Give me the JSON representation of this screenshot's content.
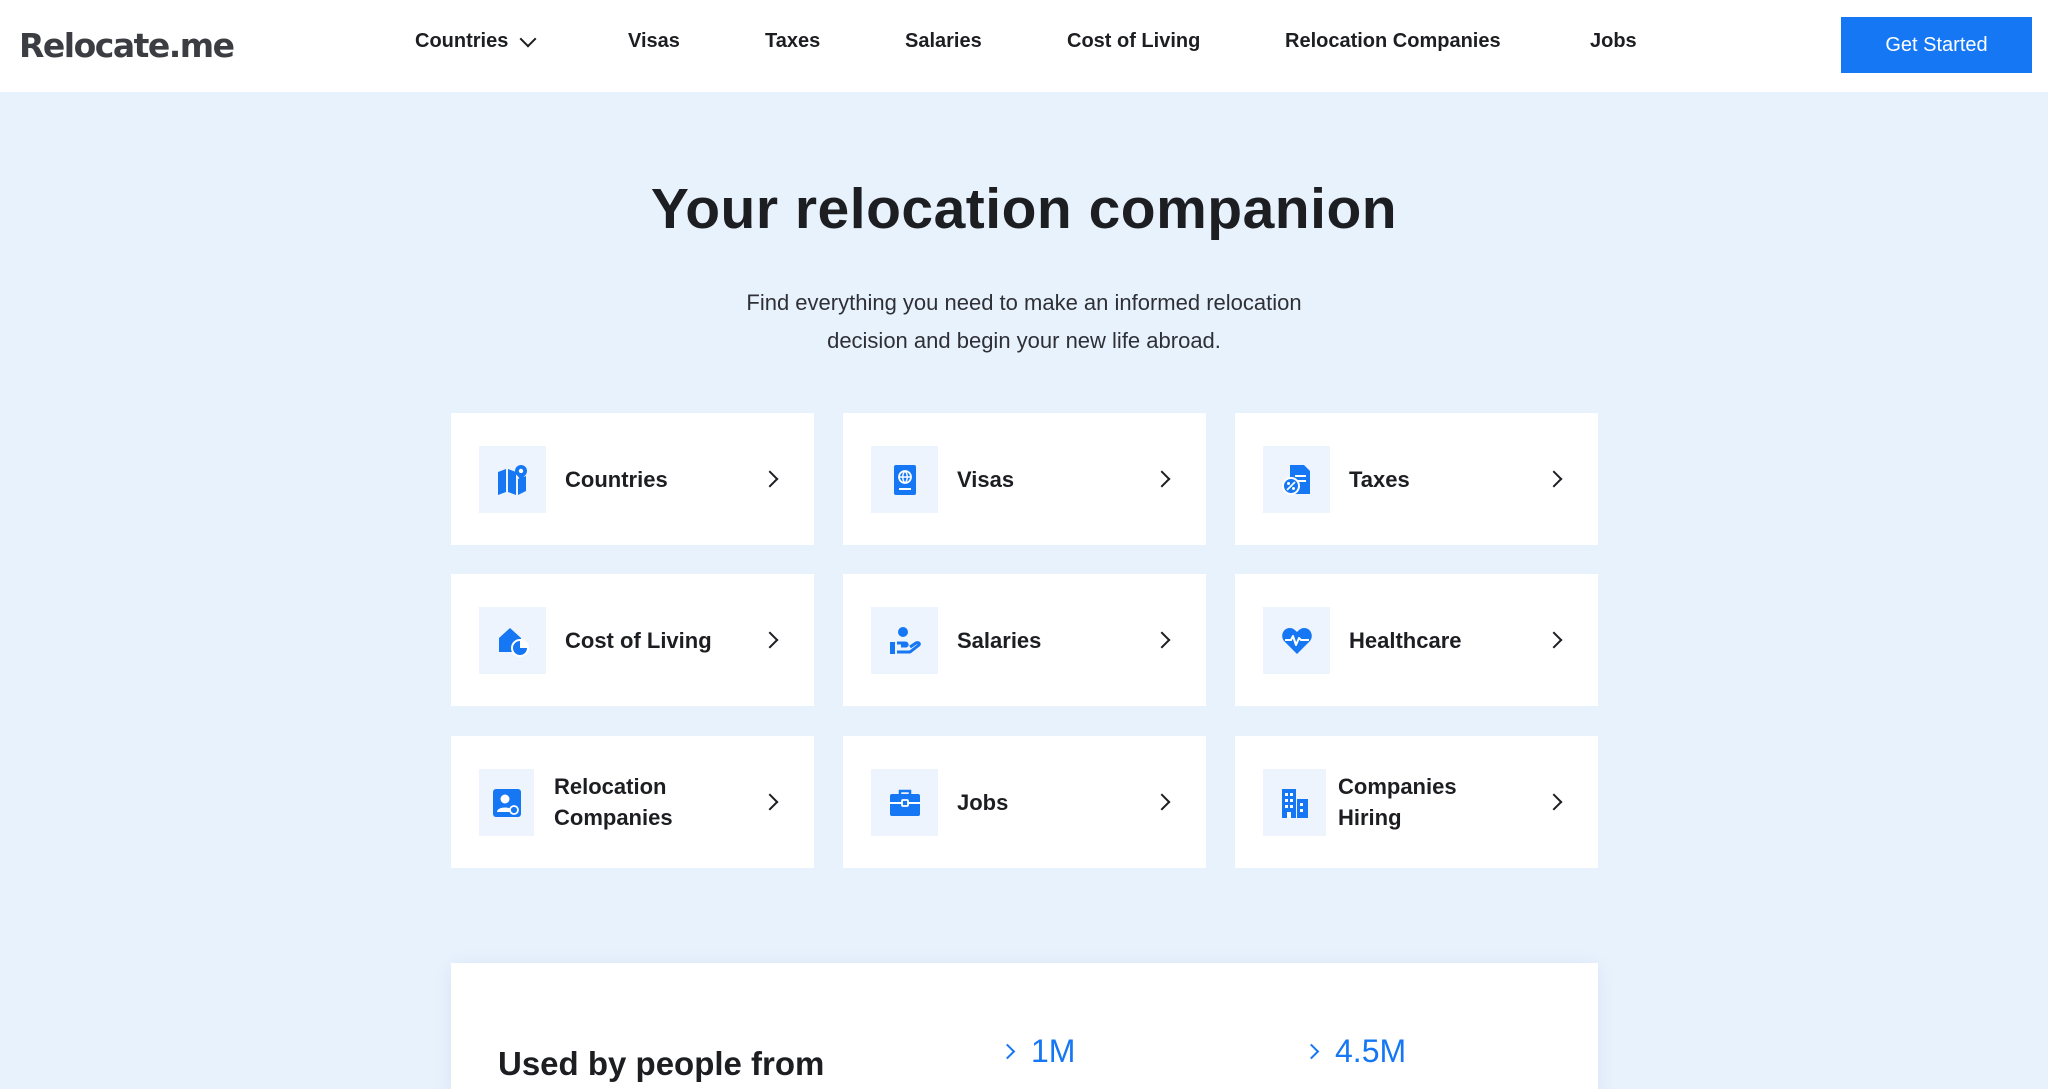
{
  "brand": {
    "logo": "Relocate.me"
  },
  "nav": {
    "items": [
      "Countries",
      "Visas",
      "Taxes",
      "Salaries",
      "Cost of Living",
      "Relocation Companies",
      "Jobs"
    ],
    "cta": "Get Started"
  },
  "hero": {
    "title": "Your relocation companion",
    "subtitle_line1": "Find everything you need to make an informed relocation",
    "subtitle_line2": "decision and begin your new life abroad."
  },
  "cards": [
    {
      "label": "Countries",
      "icon": "map-pin-icon"
    },
    {
      "label": "Visas",
      "icon": "passport-icon"
    },
    {
      "label": "Taxes",
      "icon": "tax-document-icon"
    },
    {
      "label": "Cost of Living",
      "icon": "house-price-icon"
    },
    {
      "label": "Salaries",
      "icon": "hand-coin-icon"
    },
    {
      "label": "Healthcare",
      "icon": "heart-pulse-icon"
    },
    {
      "label": "Relocation Companies",
      "icon": "id-badge-icon"
    },
    {
      "label": "Jobs",
      "icon": "briefcase-icon"
    },
    {
      "label": "Companies Hiring",
      "icon": "buildings-icon"
    }
  ],
  "stats": {
    "title": "Used by people from",
    "items": [
      "1M",
      "4.5M"
    ]
  },
  "colors": {
    "accent": "#1577f3",
    "background": "#e8f2fd",
    "icon_bg": "#eef4fd"
  }
}
